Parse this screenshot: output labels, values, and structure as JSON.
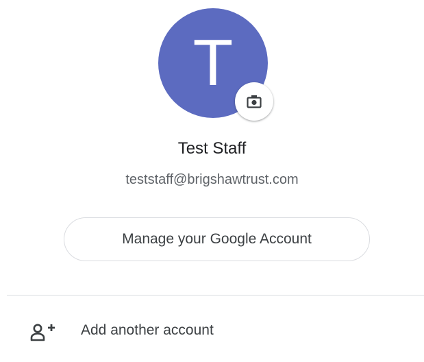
{
  "profile": {
    "avatar_letter": "T",
    "avatar_color": "#5c6bc0",
    "name": "Test Staff",
    "email": "teststaff@brigshawtrust.com"
  },
  "actions": {
    "manage_account_label": "Manage your Google Account",
    "add_account_label": "Add another account"
  },
  "icons": {
    "camera": "camera-icon",
    "add_person": "add-person-icon"
  }
}
